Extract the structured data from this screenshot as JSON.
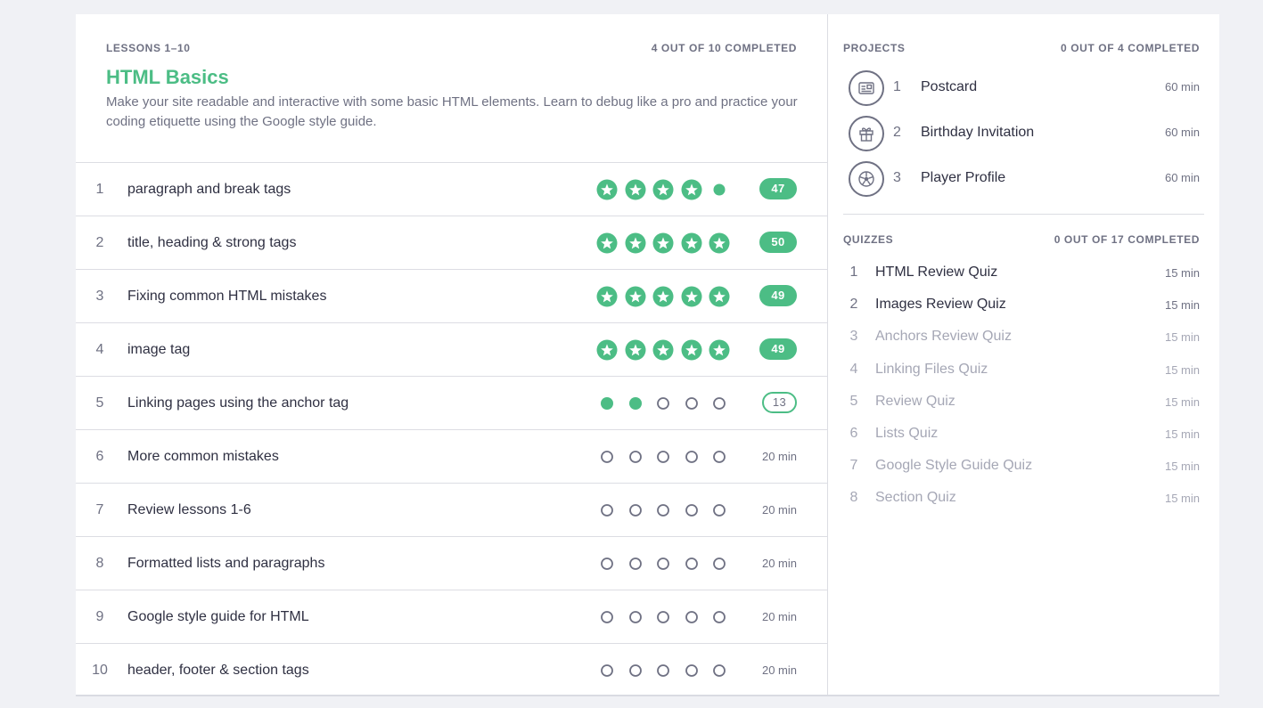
{
  "colors": {
    "accent": "#4cbd85",
    "muted_text": "#6f7183",
    "locked_text": "#a5a7b5",
    "background": "#f0f1f5"
  },
  "lessons_header": {
    "range_label": "LESSONS 1–10",
    "completed_label": "4 OUT OF 10 COMPLETED",
    "title": "HTML Basics",
    "description": "Make your site readable and interactive with some basic HTML elements. Learn to debug like a pro and practice your coding etiquette using the Google style guide."
  },
  "lessons": [
    {
      "num": "1",
      "name": "paragraph and break tags",
      "marks": [
        "star",
        "star",
        "star",
        "star",
        "dot"
      ],
      "score": "47",
      "score_style": "filled",
      "duration": ""
    },
    {
      "num": "2",
      "name": "title, heading & strong tags",
      "marks": [
        "star",
        "star",
        "star",
        "star",
        "star"
      ],
      "score": "50",
      "score_style": "filled",
      "duration": ""
    },
    {
      "num": "3",
      "name": "Fixing common HTML mistakes",
      "marks": [
        "star",
        "star",
        "star",
        "star",
        "star"
      ],
      "score": "49",
      "score_style": "filled",
      "duration": ""
    },
    {
      "num": "4",
      "name": "image tag",
      "marks": [
        "star",
        "star",
        "star",
        "star",
        "star"
      ],
      "score": "49",
      "score_style": "filled",
      "duration": ""
    },
    {
      "num": "5",
      "name": "Linking pages using the anchor tag",
      "marks": [
        "filled",
        "filled",
        "empty",
        "empty",
        "empty"
      ],
      "score": "13",
      "score_style": "outline",
      "duration": ""
    },
    {
      "num": "6",
      "name": "More common mistakes",
      "marks": [
        "empty",
        "empty",
        "empty",
        "empty",
        "empty"
      ],
      "score": "",
      "score_style": "none",
      "duration": "20 min"
    },
    {
      "num": "7",
      "name": "Review lessons 1-6",
      "marks": [
        "empty",
        "empty",
        "empty",
        "empty",
        "empty"
      ],
      "score": "",
      "score_style": "none",
      "duration": "20 min"
    },
    {
      "num": "8",
      "name": "Formatted lists and paragraphs",
      "marks": [
        "empty",
        "empty",
        "empty",
        "empty",
        "empty"
      ],
      "score": "",
      "score_style": "none",
      "duration": "20 min"
    },
    {
      "num": "9",
      "name": "Google style guide for HTML",
      "marks": [
        "empty",
        "empty",
        "empty",
        "empty",
        "empty"
      ],
      "score": "",
      "score_style": "none",
      "duration": "20 min"
    },
    {
      "num": "10",
      "name": "header, footer & section tags",
      "marks": [
        "empty",
        "empty",
        "empty",
        "empty",
        "empty"
      ],
      "score": "",
      "score_style": "none",
      "duration": "20 min"
    }
  ],
  "projects": {
    "label": "PROJECTS",
    "completed_label": "0 OUT OF 4 COMPLETED",
    "items": [
      {
        "num": "1",
        "name": "Postcard",
        "duration": "60 min",
        "icon": "postcard-icon"
      },
      {
        "num": "2",
        "name": "Birthday Invitation",
        "duration": "60 min",
        "icon": "gift-icon"
      },
      {
        "num": "3",
        "name": "Player Profile",
        "duration": "60 min",
        "icon": "soccer-ball-icon"
      }
    ]
  },
  "quizzes": {
    "label": "QUIZZES",
    "completed_label": "0 OUT OF 17 COMPLETED",
    "items": [
      {
        "num": "1",
        "name": "HTML Review Quiz",
        "duration": "15 min",
        "locked": false
      },
      {
        "num": "2",
        "name": "Images Review Quiz",
        "duration": "15 min",
        "locked": false
      },
      {
        "num": "3",
        "name": "Anchors Review Quiz",
        "duration": "15 min",
        "locked": true
      },
      {
        "num": "4",
        "name": "Linking Files Quiz",
        "duration": "15 min",
        "locked": true
      },
      {
        "num": "5",
        "name": "Review Quiz",
        "duration": "15 min",
        "locked": true
      },
      {
        "num": "6",
        "name": "Lists Quiz",
        "duration": "15 min",
        "locked": true
      },
      {
        "num": "7",
        "name": "Google Style Guide Quiz",
        "duration": "15 min",
        "locked": true
      },
      {
        "num": "8",
        "name": "Section Quiz",
        "duration": "15 min",
        "locked": true
      }
    ]
  }
}
